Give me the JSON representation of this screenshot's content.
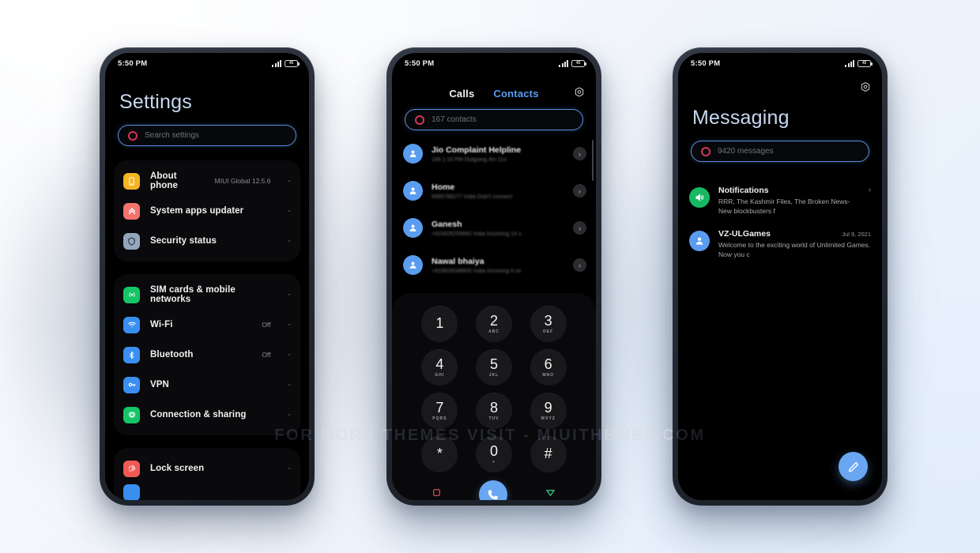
{
  "watermark": "FOR MORE THEMES VISIT - MIUITHEMEZ.COM",
  "colors": {
    "accent_blue": "#5a9cf0",
    "search_border": "#5a8ee0",
    "search_icon_red": "#d6355a",
    "title_blue": "#c6d8ef",
    "green": "#18b862",
    "screen_black": "#000000"
  },
  "statusbar": {
    "time": "5:50 PM",
    "battery_label": "45"
  },
  "phone1": {
    "title": "Settings",
    "search": {
      "placeholder": "Search settings",
      "icon": "search-circle-icon"
    },
    "groups": [
      {
        "items": [
          {
            "label": "About phone",
            "value": "MIUI Global 12.5.6",
            "icon": "phone-icon",
            "color": "#f5b421"
          },
          {
            "label": "System apps updater",
            "value": "",
            "icon": "double-chevron-up-icon",
            "color": "#f3726d"
          },
          {
            "label": "Security status",
            "value": "",
            "icon": "shield-icon",
            "color": "#93a6bd"
          }
        ]
      },
      {
        "items": [
          {
            "label": "SIM cards & mobile networks",
            "value": "",
            "icon": "sim-signal-icon",
            "color": "#16c567"
          },
          {
            "label": "Wi-Fi",
            "value": "Off",
            "icon": "wifi-icon",
            "color": "#3a8ef0"
          },
          {
            "label": "Bluetooth",
            "value": "Off",
            "icon": "bluetooth-icon",
            "color": "#3a8ef0"
          },
          {
            "label": "VPN",
            "value": "",
            "icon": "key-icon",
            "color": "#3a8ef0"
          },
          {
            "label": "Connection & sharing",
            "value": "",
            "icon": "connection-sharing-icon",
            "color": "#16c567"
          }
        ]
      },
      {
        "items": [
          {
            "label": "Lock screen",
            "value": "",
            "icon": "fingerprint-icon",
            "color": "#f05a55"
          }
        ]
      }
    ]
  },
  "phone2": {
    "tabs": [
      {
        "label": "Calls",
        "active": true
      },
      {
        "label": "Contacts",
        "active": false
      }
    ],
    "settings_icon": "gear-icon",
    "search": {
      "placeholder": "167 contacts",
      "icon": "search-circle-icon"
    },
    "contacts": [
      {
        "name": "Jio Complaint Helpline",
        "sub": "198  1:10 PM Outgoing  4m 21s"
      },
      {
        "name": "Home",
        "sub": "8989788277 India  Didn't connect"
      },
      {
        "name": "Ganesh",
        "sub": "+919326255662 India  Incoming  14 s"
      },
      {
        "name": "Nawal bhaiya",
        "sub": "+919926048805 India  Incoming  6 se"
      }
    ],
    "dialpad": [
      {
        "digit": "1",
        "letters": ""
      },
      {
        "digit": "2",
        "letters": "ABC"
      },
      {
        "digit": "3",
        "letters": "DEF"
      },
      {
        "digit": "4",
        "letters": "GHI"
      },
      {
        "digit": "5",
        "letters": "JKL"
      },
      {
        "digit": "6",
        "letters": "MNO"
      },
      {
        "digit": "7",
        "letters": "PQRS"
      },
      {
        "digit": "8",
        "letters": "TUV"
      },
      {
        "digit": "9",
        "letters": "WXYZ"
      },
      {
        "digit": "*",
        "letters": ""
      },
      {
        "digit": "0",
        "letters": "+"
      },
      {
        "digit": "#",
        "letters": ""
      }
    ],
    "actions": {
      "recents_icon": "square-icon",
      "call_icon": "phone-handset-icon",
      "back_icon": "triangle-down-icon"
    }
  },
  "phone3": {
    "title": "Messaging",
    "settings_icon": "gear-icon",
    "search": {
      "placeholder": "9420 messages",
      "icon": "search-circle-icon"
    },
    "messages": [
      {
        "title": "Notifications",
        "date": "",
        "body": "RRR, The Kashmir Files, The Broken News- New blockbusters f",
        "icon": "speaker-icon",
        "color": "#18b862"
      },
      {
        "title": "VZ-ULGames",
        "date": "Jul 9, 2021",
        "body": "Welcome to the exciting world of Unlimited Games. Now you c",
        "icon": "contact-avatar-icon",
        "color": "#5a9cf0"
      }
    ],
    "fab_icon": "compose-pencil-icon"
  }
}
